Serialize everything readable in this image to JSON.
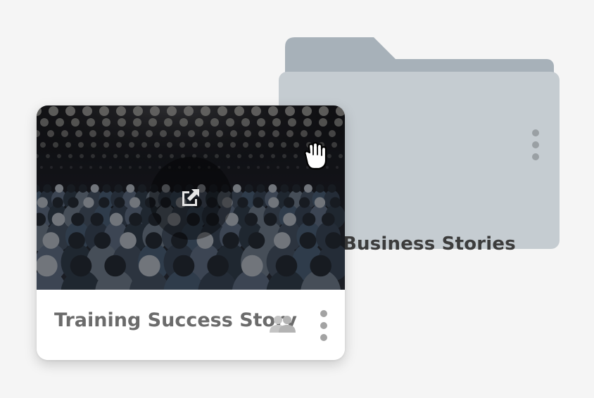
{
  "folder": {
    "name": "Business Stories",
    "menu_icon": "vertical-ellipsis-icon"
  },
  "project_card": {
    "title": "Training Success Story",
    "thumbnail": "conference-audience-image",
    "open_icon": "external-link-icon",
    "shared_icon": "shared-users-icon",
    "menu_icon": "vertical-ellipsis-icon"
  },
  "cursor": {
    "icon": "grab-hand-icon"
  },
  "colors": {
    "background": "#f5f5f5",
    "folder_front": "#c5ccd1",
    "folder_back": "#a7b1b9",
    "card": "#ffffff",
    "title_text": "#6b6b6b",
    "folder_text": "#3c3c3c"
  }
}
